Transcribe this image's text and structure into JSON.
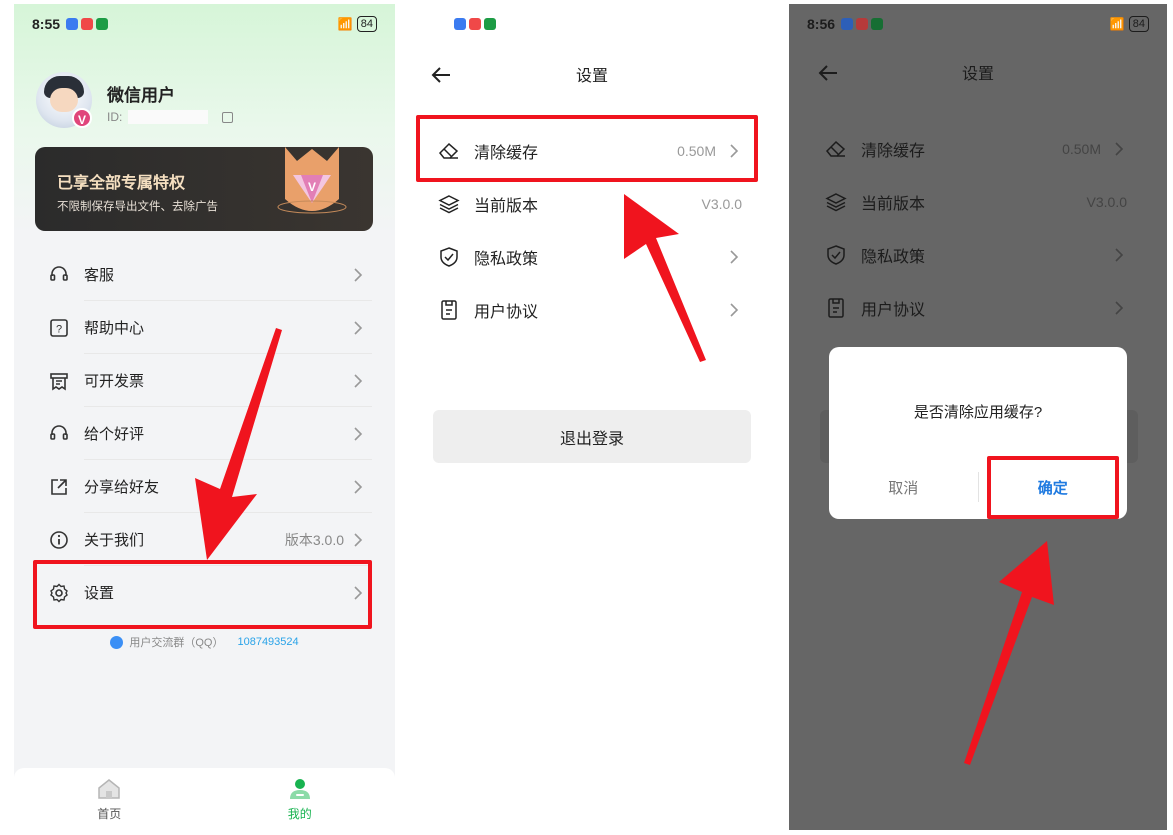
{
  "colors": {
    "accent_green": "#17b350",
    "highlight_red": "#f0141e",
    "link_blue": "#1f7ae0",
    "vip_gold": "#f5dfc0"
  },
  "panel1": {
    "status": {
      "time": "8:55",
      "battery": "84"
    },
    "profile": {
      "name": "微信用户",
      "id_label": "ID:"
    },
    "vip": {
      "title": "已享全部专属特权",
      "subtitle": "不限制保存导出文件、去除广告"
    },
    "menu": [
      {
        "label": "客服",
        "icon": "headset-icon"
      },
      {
        "label": "帮助中心",
        "icon": "help-icon"
      },
      {
        "label": "可开发票",
        "icon": "invoice-icon"
      },
      {
        "label": "给个好评",
        "icon": "headset-icon"
      },
      {
        "label": "分享给好友",
        "icon": "share-icon"
      },
      {
        "label": "关于我们",
        "icon": "info-icon",
        "value": "版本3.0.0"
      },
      {
        "label": "设置",
        "icon": "gear-icon"
      }
    ],
    "qq_group": {
      "label": "用户交流群（QQ）",
      "number": "1087493524"
    },
    "tabs": [
      {
        "label": "首页",
        "icon": "home-icon"
      },
      {
        "label": "我的",
        "icon": "person-icon"
      }
    ]
  },
  "panel2": {
    "title": "设置",
    "items": [
      {
        "label": "清除缓存",
        "value": "0.50M",
        "icon": "eraser-icon"
      },
      {
        "label": "当前版本",
        "value": "V3.0.0",
        "icon": "layers-icon"
      },
      {
        "label": "隐私政策",
        "icon": "shield-icon"
      },
      {
        "label": "用户协议",
        "icon": "document-icon"
      }
    ],
    "logout": "退出登录"
  },
  "panel3": {
    "status": {
      "time": "8:56",
      "battery": "84"
    },
    "title": "设置",
    "items": [
      {
        "label": "清除缓存",
        "value": "0.50M"
      },
      {
        "label": "当前版本",
        "value": "V3.0.0"
      },
      {
        "label": "隐私政策"
      },
      {
        "label": "用户协议"
      }
    ],
    "dialog": {
      "message": "是否清除应用缓存?",
      "cancel": "取消",
      "confirm": "确定"
    }
  }
}
